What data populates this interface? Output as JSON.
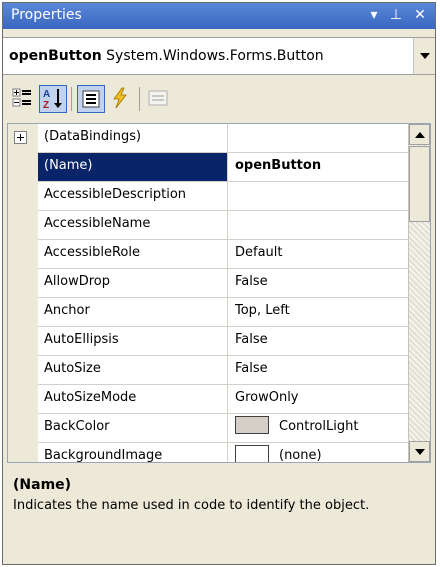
{
  "window": {
    "title": "Properties"
  },
  "titlebar_buttons": {
    "dropdown": "▾",
    "pin": "⊥",
    "close": "✕"
  },
  "selector": {
    "object_name": "openButton",
    "object_type": "System.Windows.Forms.Button"
  },
  "toolbar": {
    "tools": [
      "categorized-icon",
      "alphabetical-icon",
      "properties-icon",
      "events-icon",
      "property-pages-icon"
    ],
    "active": [
      "alphabetical-icon",
      "properties-icon"
    ]
  },
  "properties": [
    {
      "name": "(DataBindings)",
      "value": "",
      "expandable": true
    },
    {
      "name": "(Name)",
      "value": "openButton",
      "selected": true
    },
    {
      "name": "AccessibleDescription",
      "value": ""
    },
    {
      "name": "AccessibleName",
      "value": ""
    },
    {
      "name": "AccessibleRole",
      "value": "Default"
    },
    {
      "name": "AllowDrop",
      "value": "False"
    },
    {
      "name": "Anchor",
      "value": "Top, Left"
    },
    {
      "name": "AutoEllipsis",
      "value": "False"
    },
    {
      "name": "AutoSize",
      "value": "False"
    },
    {
      "name": "AutoSizeMode",
      "value": "GrowOnly"
    },
    {
      "name": "BackColor",
      "value": "ControlLight",
      "swatch": "#d4d0c8"
    },
    {
      "name": "BackgroundImage",
      "value": "(none)",
      "swatch": "#ffffff"
    }
  ],
  "description": {
    "title": "(Name)",
    "text": "Indicates the name used in code to identify the object."
  },
  "colors": {
    "selection": "#0a246a",
    "titlebar": "#3a66c0",
    "panel": "#ece9d8"
  }
}
